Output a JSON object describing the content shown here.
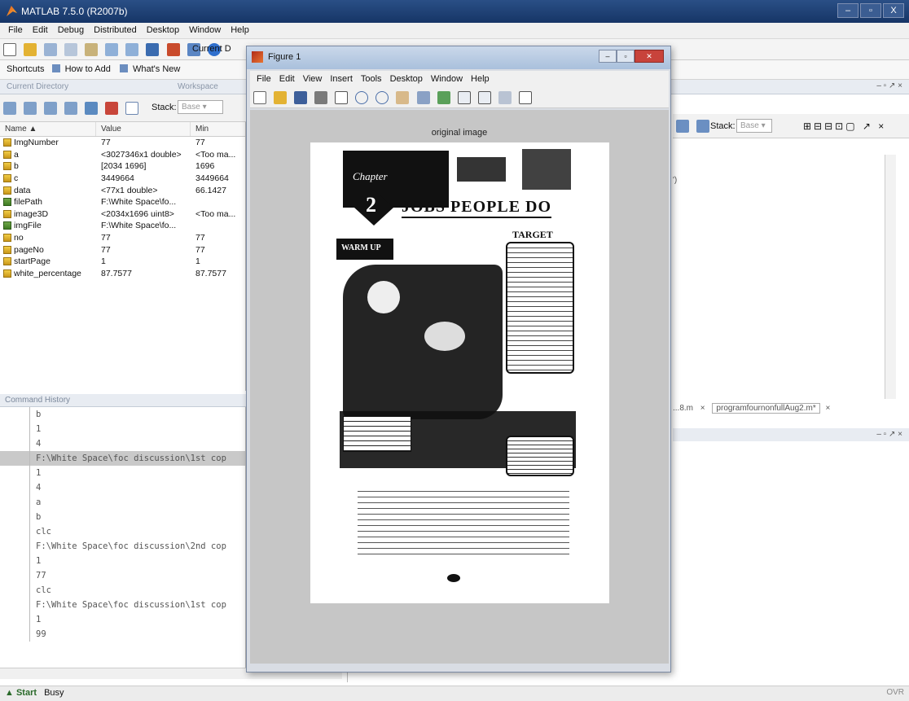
{
  "app": {
    "title": "MATLAB 7.5.0 (R2007b)",
    "window_buttons": [
      "–",
      "▫",
      "X"
    ]
  },
  "menu": [
    "File",
    "Edit",
    "Debug",
    "Distributed",
    "Desktop",
    "Window",
    "Help"
  ],
  "toolbar": {
    "current_dir_label": "Current D"
  },
  "shortcuts": {
    "label": "Shortcuts",
    "how_to_add": "How to Add",
    "whats_new": "What's New"
  },
  "panels": {
    "current_directory": "Current Directory",
    "workspace": "Workspace",
    "command_history": "Command History",
    "stack_label": "Stack:",
    "stack_value": "Base"
  },
  "workspace": {
    "headers": [
      "Name ▲",
      "Value",
      "Min"
    ],
    "rows": [
      {
        "name": "ImgNumber",
        "value": "77",
        "min": "77",
        "icon": "matrix"
      },
      {
        "name": "a",
        "value": "<3027346x1 double>",
        "min": "<Too ma...",
        "icon": "matrix"
      },
      {
        "name": "b",
        "value": "[2034 1696]",
        "min": "1696",
        "icon": "matrix"
      },
      {
        "name": "c",
        "value": "3449664",
        "min": "3449664",
        "icon": "matrix"
      },
      {
        "name": "data",
        "value": "<77x1 double>",
        "min": "66.1427",
        "icon": "matrix"
      },
      {
        "name": "filePath",
        "value": "F:\\White Space\\fo...",
        "min": "",
        "icon": "char"
      },
      {
        "name": "image3D",
        "value": "<2034x1696 uint8>",
        "min": "<Too ma...",
        "icon": "matrix"
      },
      {
        "name": "imgFile",
        "value": "F:\\White Space\\fo...",
        "min": "",
        "icon": "char"
      },
      {
        "name": "no",
        "value": "77",
        "min": "77",
        "icon": "matrix"
      },
      {
        "name": "pageNo",
        "value": "77",
        "min": "77",
        "icon": "matrix"
      },
      {
        "name": "startPage",
        "value": "1",
        "min": "1",
        "icon": "matrix"
      },
      {
        "name": "white_percentage",
        "value": "87.7577",
        "min": "87.7577",
        "icon": "matrix"
      }
    ]
  },
  "history": [
    {
      "text": "b",
      "hl": false
    },
    {
      "text": "1",
      "hl": false
    },
    {
      "text": "4",
      "hl": false
    },
    {
      "text": "F:\\White Space\\foc discussion\\1st cop",
      "hl": true
    },
    {
      "text": "1",
      "hl": false
    },
    {
      "text": "4",
      "hl": false
    },
    {
      "text": "a",
      "hl": false
    },
    {
      "text": "b",
      "hl": false
    },
    {
      "text": "clc",
      "hl": false
    },
    {
      "text": "F:\\White Space\\foc discussion\\2nd cop",
      "hl": false
    },
    {
      "text": "1",
      "hl": false
    },
    {
      "text": "77",
      "hl": false
    },
    {
      "text": "clc",
      "hl": false
    },
    {
      "text": "F:\\White Space\\foc discussion\\1st cop",
      "hl": false
    },
    {
      "text": "1",
      "hl": false
    },
    {
      "text": "99",
      "hl": false
    }
  ],
  "editor_tabs": {
    "tab1": "...8.m",
    "tab2": "programfournonfullAug2.m*"
  },
  "status": {
    "start": "Start",
    "text": "Busy",
    "ovr": "OVR"
  },
  "figure": {
    "title": "Figure 1",
    "menu": [
      "File",
      "Edit",
      "View",
      "Insert",
      "Tools",
      "Desktop",
      "Window",
      "Help"
    ],
    "axes_title": "original image",
    "close_glyph": "✕"
  },
  "page_image": {
    "chapter_word": "Chapter",
    "chapter_num": "2",
    "heading": "JOBS PEOPLE DO",
    "target_label": "TARGET",
    "warm_up": "WARM UP"
  }
}
